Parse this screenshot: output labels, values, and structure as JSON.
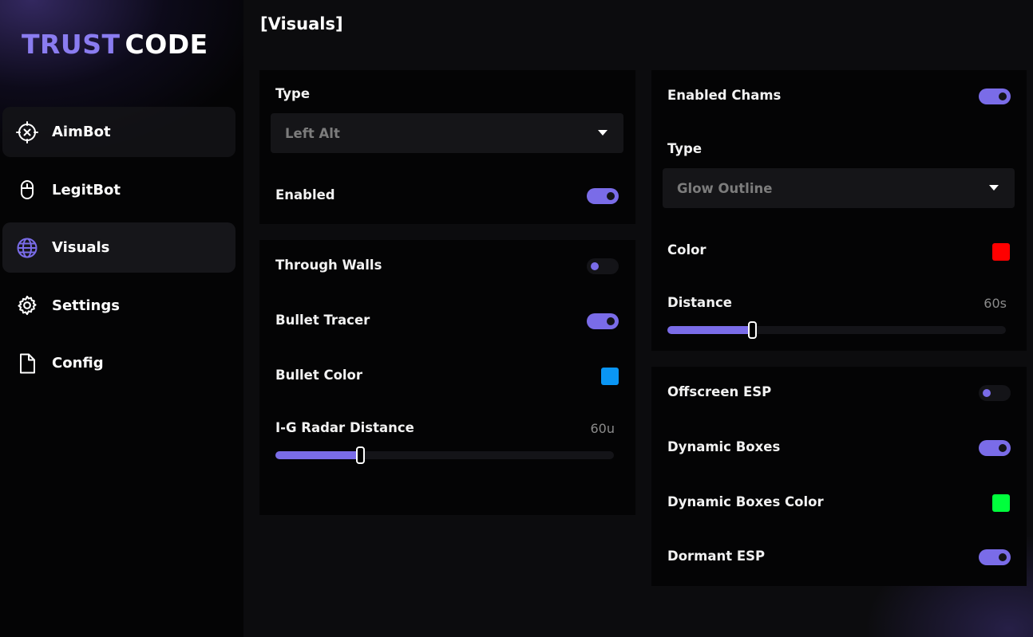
{
  "brand": {
    "part1": "TRUST",
    "part2": "CODE"
  },
  "nav": [
    {
      "label": "AimBot",
      "icon": "crosshair-icon"
    },
    {
      "label": "LegitBot",
      "icon": "mouse-icon"
    },
    {
      "label": "Visuals",
      "icon": "globe-icon",
      "active": true
    },
    {
      "label": "Settings",
      "icon": "gear-icon"
    },
    {
      "label": "Config",
      "icon": "file-icon"
    }
  ],
  "page": {
    "title": "[Visuals]"
  },
  "panel1": {
    "type_label": "Type",
    "type_value": "Left Alt",
    "enabled_label": "Enabled",
    "enabled": true
  },
  "panel2": {
    "through_walls_label": "Through Walls",
    "through_walls": false,
    "bullet_tracer_label": "Bullet Tracer",
    "bullet_tracer": true,
    "bullet_color_label": "Bullet Color",
    "bullet_color": "#0a96f5",
    "radar_label": "I-G Radar Distance",
    "radar_value": "60u",
    "radar_fraction": 0.25
  },
  "panel3": {
    "chams_label": "Enabled Chams",
    "chams": true,
    "type_label": "Type",
    "type_value": "Glow Outline",
    "color_label": "Color",
    "color": "#ff0000",
    "distance_label": "Distance",
    "distance_value": "60s",
    "distance_fraction": 0.25
  },
  "panel4": {
    "offscreen_label": "Offscreen ESP",
    "offscreen": false,
    "dyn_boxes_label": "Dynamic Boxes",
    "dyn_boxes": true,
    "dyn_boxes_color_label": "Dynamic Boxes Color",
    "dyn_boxes_color": "#00ff3c",
    "dormant_label": "Dormant ESP",
    "dormant": true
  },
  "colors": {
    "accent": "#7a6ce8",
    "brand": "#8a7cf0"
  }
}
